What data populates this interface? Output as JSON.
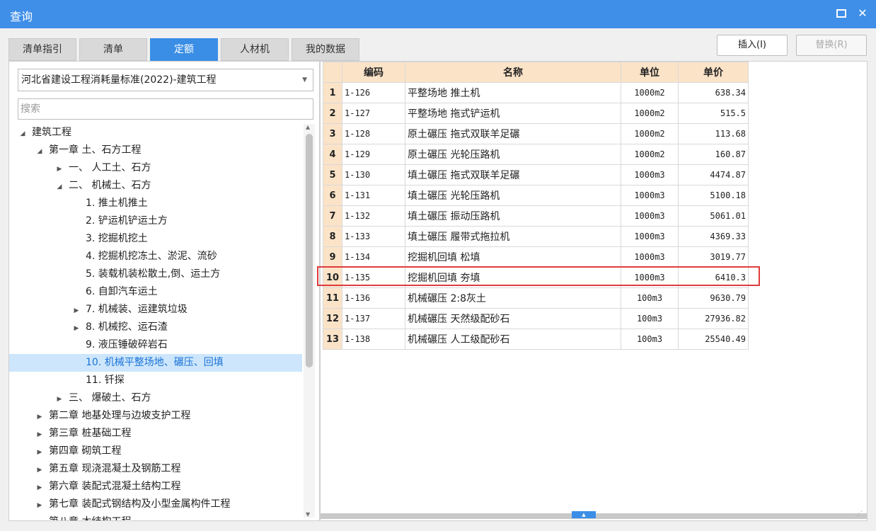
{
  "window": {
    "title": "查询",
    "max_icon": "maximize-icon",
    "close_icon": "close-icon",
    "close_glyph": "✕"
  },
  "tabs": [
    {
      "label": "清单指引",
      "active": false
    },
    {
      "label": "清单",
      "active": false
    },
    {
      "label": "定额",
      "active": true
    },
    {
      "label": "人材机",
      "active": false
    },
    {
      "label": "我的数据",
      "active": false
    }
  ],
  "buttons": {
    "insert": "插入(I)",
    "replace": "替换(R)"
  },
  "library": {
    "selected": "河北省建设工程消耗量标准(2022)-建筑工程"
  },
  "search": {
    "placeholder": "搜索"
  },
  "tree": [
    {
      "label": "建筑工程",
      "level": 0,
      "toggle": "expanded"
    },
    {
      "label": "第一章 土、石方工程",
      "level": 1,
      "toggle": "expanded"
    },
    {
      "label": "一、 人工土、石方",
      "level": 2,
      "toggle": "collapsed"
    },
    {
      "label": "二、 机械土、石方",
      "level": 2,
      "toggle": "expanded"
    },
    {
      "label": "1. 推土机推土",
      "level": 3,
      "toggle": "none"
    },
    {
      "label": "2. 铲运机铲运土方",
      "level": 3,
      "toggle": "none"
    },
    {
      "label": "3. 挖掘机挖土",
      "level": 3,
      "toggle": "none"
    },
    {
      "label": "4. 挖掘机挖冻土、淤泥、流砂",
      "level": 3,
      "toggle": "none"
    },
    {
      "label": "5. 装载机装松散土,倒、运土方",
      "level": 3,
      "toggle": "none"
    },
    {
      "label": "6. 自卸汽车运土",
      "level": 3,
      "toggle": "none"
    },
    {
      "label": "7. 机械装、运建筑垃圾",
      "level": 3,
      "toggle": "collapsed"
    },
    {
      "label": "8. 机械挖、运石渣",
      "level": 3,
      "toggle": "collapsed"
    },
    {
      "label": "9. 液压锤破碎岩石",
      "level": 3,
      "toggle": "none"
    },
    {
      "label": "10. 机械平整场地、碾压、回填",
      "level": 3,
      "toggle": "none",
      "selected": true
    },
    {
      "label": "11. 钎探",
      "level": 3,
      "toggle": "none"
    },
    {
      "label": "三、 爆破土、石方",
      "level": 2,
      "toggle": "collapsed"
    },
    {
      "label": "第二章 地基处理与边坡支护工程",
      "level": 1,
      "toggle": "collapsed"
    },
    {
      "label": "第三章 桩基础工程",
      "level": 1,
      "toggle": "collapsed"
    },
    {
      "label": "第四章 砌筑工程",
      "level": 1,
      "toggle": "collapsed"
    },
    {
      "label": "第五章 现浇混凝土及钢筋工程",
      "level": 1,
      "toggle": "collapsed"
    },
    {
      "label": "第六章 装配式混凝土结构工程",
      "level": 1,
      "toggle": "collapsed"
    },
    {
      "label": "第七章 装配式钢结构及小型金属构件工程",
      "level": 1,
      "toggle": "collapsed"
    },
    {
      "label": "第八章 木结构工程",
      "level": 1,
      "toggle": "collapsed"
    }
  ],
  "table": {
    "columns": [
      "编码",
      "名称",
      "单位",
      "单价"
    ],
    "rows": [
      {
        "no": "1",
        "code": "1-126",
        "name": "平整场地 推土机",
        "unit": "1000m2",
        "price": "638.34"
      },
      {
        "no": "2",
        "code": "1-127",
        "name": "平整场地 拖式铲运机",
        "unit": "1000m2",
        "price": "515.5"
      },
      {
        "no": "3",
        "code": "1-128",
        "name": "原土碾压 拖式双联羊足碾",
        "unit": "1000m2",
        "price": "113.68"
      },
      {
        "no": "4",
        "code": "1-129",
        "name": "原土碾压 光轮压路机",
        "unit": "1000m2",
        "price": "160.87"
      },
      {
        "no": "5",
        "code": "1-130",
        "name": "填土碾压 拖式双联羊足碾",
        "unit": "1000m3",
        "price": "4474.87"
      },
      {
        "no": "6",
        "code": "1-131",
        "name": "填土碾压 光轮压路机",
        "unit": "1000m3",
        "price": "5100.18"
      },
      {
        "no": "7",
        "code": "1-132",
        "name": "填土碾压 振动压路机",
        "unit": "1000m3",
        "price": "5061.01"
      },
      {
        "no": "8",
        "code": "1-133",
        "name": "填土碾压 履带式拖拉机",
        "unit": "1000m3",
        "price": "4369.33"
      },
      {
        "no": "9",
        "code": "1-134",
        "name": "挖掘机回填 松填",
        "unit": "1000m3",
        "price": "3019.77"
      },
      {
        "no": "10",
        "code": "1-135",
        "name": "挖掘机回填 夯填",
        "unit": "1000m3",
        "price": "6410.3"
      },
      {
        "no": "11",
        "code": "1-136",
        "name": "机械碾压 2:8灰土",
        "unit": "100m3",
        "price": "9630.79"
      },
      {
        "no": "12",
        "code": "1-137",
        "name": "机械碾压 天然级配砂石",
        "unit": "100m3",
        "price": "27936.82"
      },
      {
        "no": "13",
        "code": "1-138",
        "name": "机械碾压 人工级配砂石",
        "unit": "100m3",
        "price": "25540.49"
      }
    ],
    "highlighted_row": 10
  },
  "colors": {
    "accent": "#3a8ee6",
    "titlebar": "#3f8fe8",
    "header_bg": "#fbe3c8",
    "highlight_border": "#e03c3c",
    "selected_bg": "#cde6fb"
  }
}
